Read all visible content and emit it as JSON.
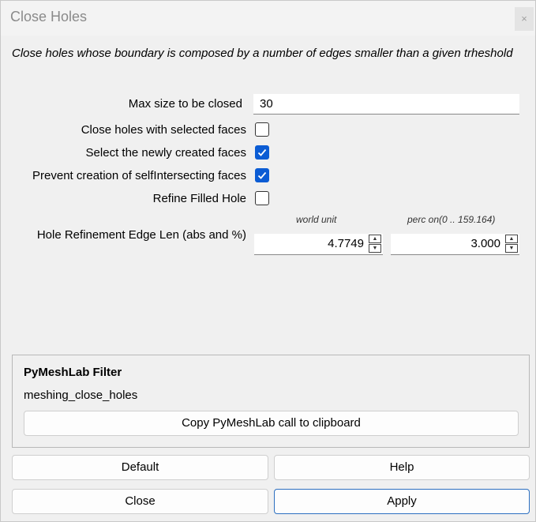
{
  "window": {
    "title": "Close Holes",
    "close_glyph": "×"
  },
  "description": "Close holes whose boundary is composed by a number of edges smaller than a given trheshold",
  "params": {
    "max_size": {
      "label": "Max size to be closed",
      "value": "30"
    },
    "close_selected": {
      "label": "Close holes with selected faces",
      "checked": false
    },
    "select_new": {
      "label": "Select the newly created faces",
      "checked": true
    },
    "prevent_self": {
      "label": "Prevent creation of selfIntersecting faces",
      "checked": true
    },
    "refine": {
      "label": "Refine Filled Hole",
      "checked": false
    },
    "edge_len": {
      "label": "Hole Refinement Edge Len (abs and %)",
      "abs_caption": "world unit",
      "perc_caption": "perc on(0 .. 159.164)",
      "abs_value": "4.7749",
      "perc_value": "3.000"
    }
  },
  "pymeshlab": {
    "title": "PyMeshLab Filter",
    "function_name": "meshing_close_holes",
    "copy_label": "Copy PyMeshLab call to clipboard"
  },
  "buttons": {
    "default": "Default",
    "help": "Help",
    "close": "Close",
    "apply": "Apply"
  },
  "colors": {
    "checkbox_accent": "#0b5cd4",
    "apply_border": "#2c6fc0"
  },
  "icons": {
    "spin_up": "▲",
    "spin_down": "▼"
  }
}
